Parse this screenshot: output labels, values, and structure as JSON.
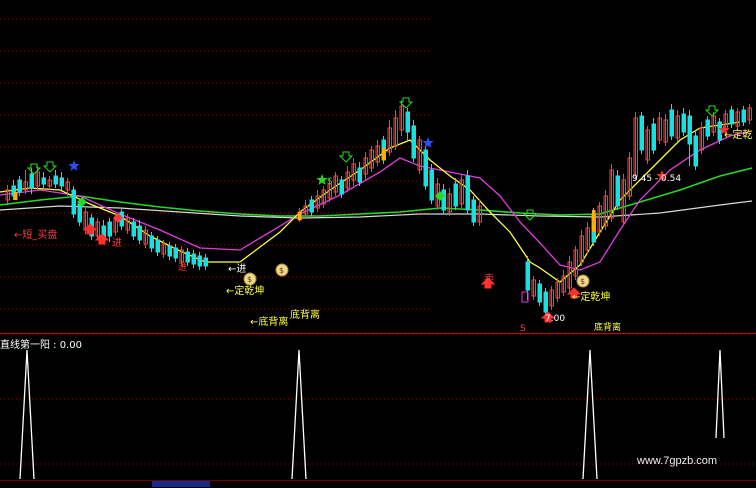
{
  "colors": {
    "up": "#ff3b3b",
    "down": "#19e0e0",
    "ma_short": "#ffff3c",
    "ma_mid": "#e03ce0",
    "ma_long": "#28d828",
    "ma_longest": "#d8d8d8",
    "grid": "#8a1010",
    "label_red": "#ff3b3b",
    "label_yellow": "#ffff3c",
    "label_white": "#ffffff"
  },
  "indicator": {
    "title": "直线第一阳 : 0.00"
  },
  "annotations": {
    "l1": "←短_买盘",
    "l2": "进",
    "l3": "←进",
    "l4": "←定乾坤",
    "l5": "底背离",
    "l6": "←底背离",
    "l7": "←定乾坤",
    "l8": "←定乾",
    "l9": "9.45 - 0.54",
    "l10": "7.00",
    "l11": "S",
    "l12": "S",
    "l13": "底背离",
    "l14": "卖"
  },
  "watermark": "www.7gpzb.com"
}
